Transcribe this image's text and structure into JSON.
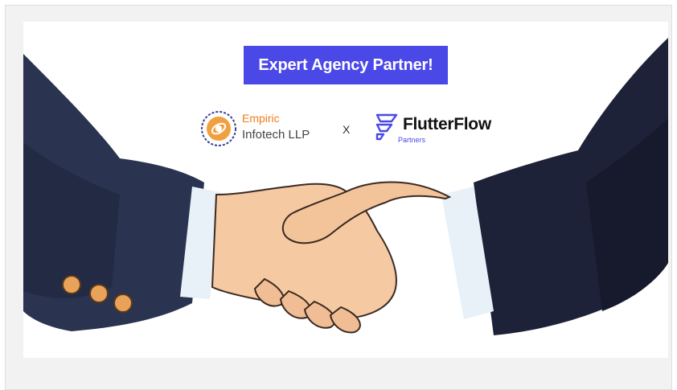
{
  "banner": {
    "headline": "Expert Agency Partner!",
    "accent_color": "#4b48e8",
    "background": "#ffffff",
    "image": "handshake-illustration"
  },
  "partner_left": {
    "name_line1": "Empiric",
    "name_line2": "Infotech LLP",
    "icon": "empiric-globe-logo",
    "color": "#f07d1a"
  },
  "separator": "X",
  "partner_right": {
    "name": "FlutterFlow",
    "subtitle": "Partners",
    "icon": "flutterflow-logo",
    "color": "#4b48e8"
  }
}
